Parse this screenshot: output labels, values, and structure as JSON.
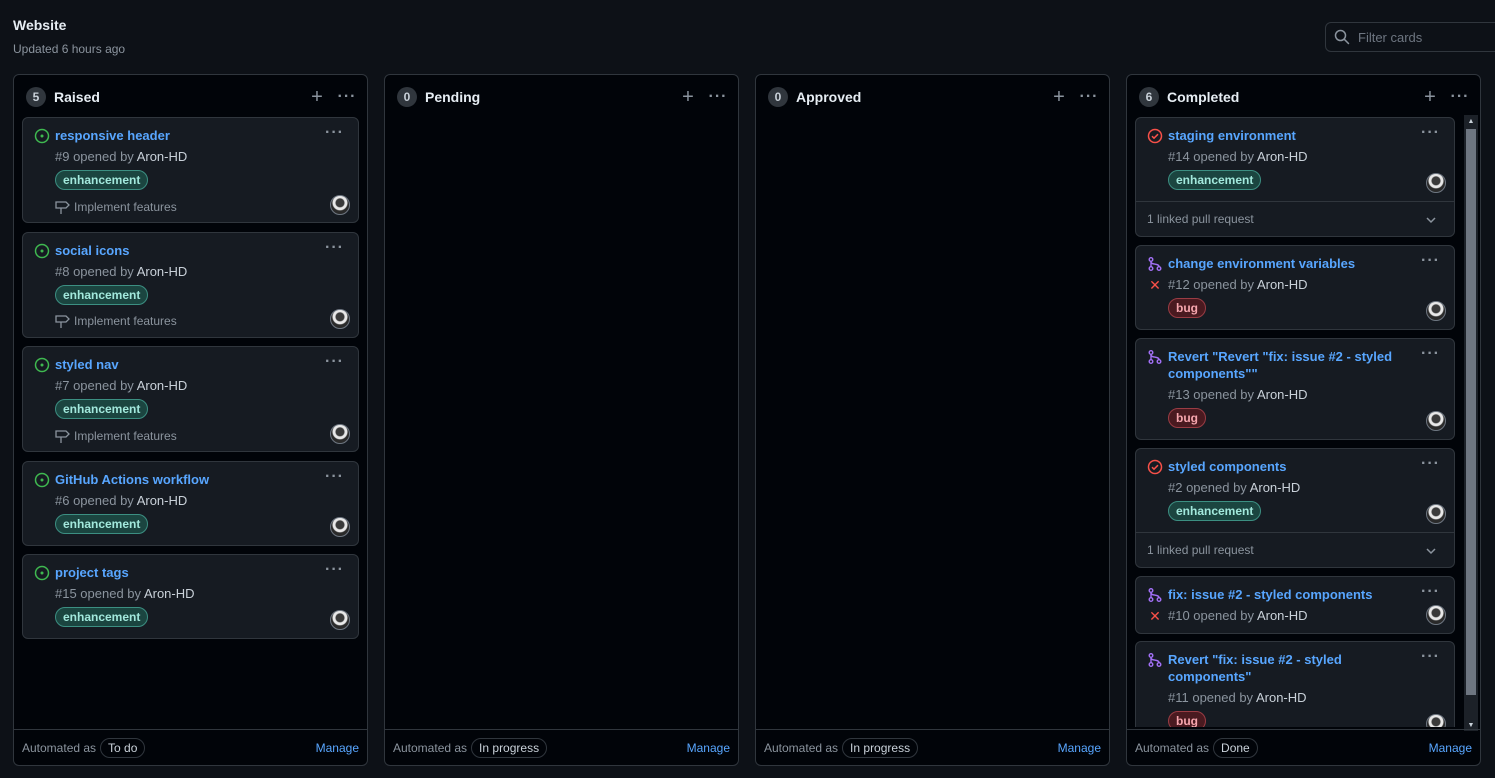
{
  "project": {
    "title": "Website",
    "updated": "Updated 6 hours ago"
  },
  "filter": {
    "placeholder": "Filter cards"
  },
  "columns": [
    {
      "count": "5",
      "name": "Raised",
      "automated_label": "Automated as",
      "automation": "To do",
      "manage": "Manage",
      "cards": [
        {
          "title": "responsive header",
          "number": "#9 opened by",
          "author": "Aron-HD",
          "label": "enhancement",
          "milestone": "Implement features",
          "state": "open-issue"
        },
        {
          "title": "social icons",
          "number": "#8 opened by",
          "author": "Aron-HD",
          "label": "enhancement",
          "milestone": "Implement features",
          "state": "open-issue"
        },
        {
          "title": "styled nav",
          "number": "#7 opened by",
          "author": "Aron-HD",
          "label": "enhancement",
          "milestone": "Implement features",
          "state": "open-issue"
        },
        {
          "title": "GitHub Actions workflow",
          "number": "#6 opened by",
          "author": "Aron-HD",
          "label": "enhancement",
          "state": "open-issue"
        },
        {
          "title": "project tags",
          "number": "#15 opened by",
          "author": "Aron-HD",
          "label": "enhancement",
          "state": "open-issue"
        }
      ]
    },
    {
      "count": "0",
      "name": "Pending",
      "automated_label": "Automated as",
      "automation": "In progress",
      "manage": "Manage",
      "cards": []
    },
    {
      "count": "0",
      "name": "Approved",
      "automated_label": "Automated as",
      "automation": "In progress",
      "manage": "Manage",
      "cards": []
    },
    {
      "count": "6",
      "name": "Completed",
      "automated_label": "Automated as",
      "automation": "Done",
      "manage": "Manage",
      "cards": [
        {
          "title": "staging environment",
          "number": "#14 opened by",
          "author": "Aron-HD",
          "label": "enhancement",
          "linked": "1 linked pull request",
          "state": "closed-issue"
        },
        {
          "title": "change environment variables",
          "number": "#12 opened by",
          "author": "Aron-HD",
          "label": "bug",
          "state": "pull-request",
          "check": "failed"
        },
        {
          "title": "Revert \"Revert \"fix: issue #2 - styled components\"\"",
          "number": "#13 opened by",
          "author": "Aron-HD",
          "label": "bug",
          "state": "pull-request"
        },
        {
          "title": "styled components",
          "number": "#2 opened by",
          "author": "Aron-HD",
          "label": "enhancement",
          "linked": "1 linked pull request",
          "state": "closed-issue"
        },
        {
          "title": "fix: issue #2 - styled components",
          "number": "#10 opened by",
          "author": "Aron-HD",
          "state": "pull-request",
          "check": "failed"
        },
        {
          "title": "Revert \"fix: issue #2 - styled components\"",
          "number": "#11 opened by",
          "author": "Aron-HD",
          "label": "bug",
          "state": "pull-request"
        }
      ]
    }
  ],
  "colors": {
    "background": "#0d1117",
    "link": "#58a6ff",
    "open": "#3fb950",
    "closed": "#f85149",
    "merged": "#a371f7"
  }
}
